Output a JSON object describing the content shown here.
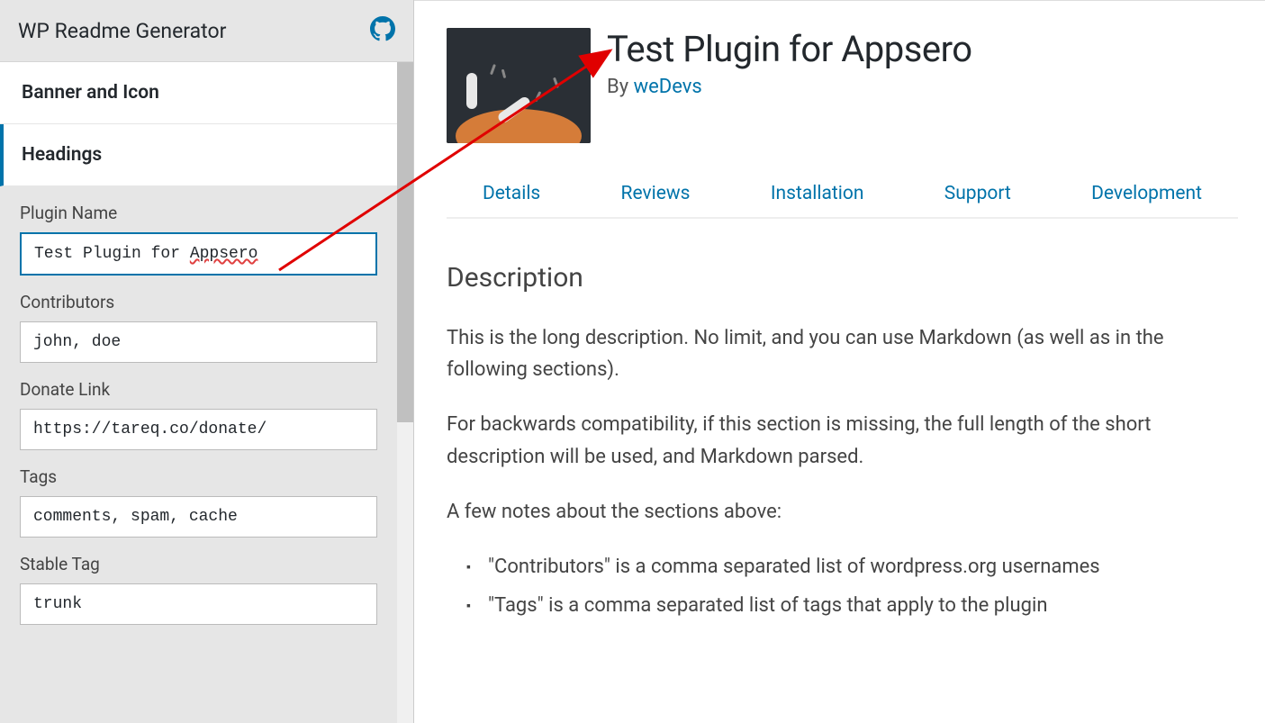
{
  "header": {
    "app_title": "WP Readme Generator"
  },
  "sidebar": {
    "tabs": [
      {
        "label": "Banner and Icon"
      },
      {
        "label": "Headings"
      }
    ],
    "form": {
      "plugin_name": {
        "label": "Plugin Name",
        "value_pre": "Test Plugin for ",
        "value_spell": "Appsero"
      },
      "contributors": {
        "label": "Contributors",
        "value": "john, doe"
      },
      "donate_link": {
        "label": "Donate Link",
        "value": "https://tareq.co/donate/"
      },
      "tags": {
        "label": "Tags",
        "value": "comments, spam, cache"
      },
      "stable_tag": {
        "label": "Stable Tag",
        "value": "trunk"
      }
    }
  },
  "preview": {
    "title": "Test Plugin for Appsero",
    "by_label": "By ",
    "author": "weDevs",
    "tabs": [
      {
        "label": "Details"
      },
      {
        "label": "Reviews"
      },
      {
        "label": "Installation"
      },
      {
        "label": "Support"
      },
      {
        "label": "Development"
      }
    ],
    "description": {
      "heading": "Description",
      "p1": "This is the long description. No limit, and you can use Markdown (as well as in the following sections).",
      "p2": "For backwards compatibility, if this section is missing, the full length of the short description will be used, and Markdown parsed.",
      "p3": "A few notes about the sections above:",
      "notes": [
        "\"Contributors\" is a comma separated list of wordpress.org usernames",
        "\"Tags\" is a comma separated list of tags that apply to the plugin"
      ]
    }
  }
}
